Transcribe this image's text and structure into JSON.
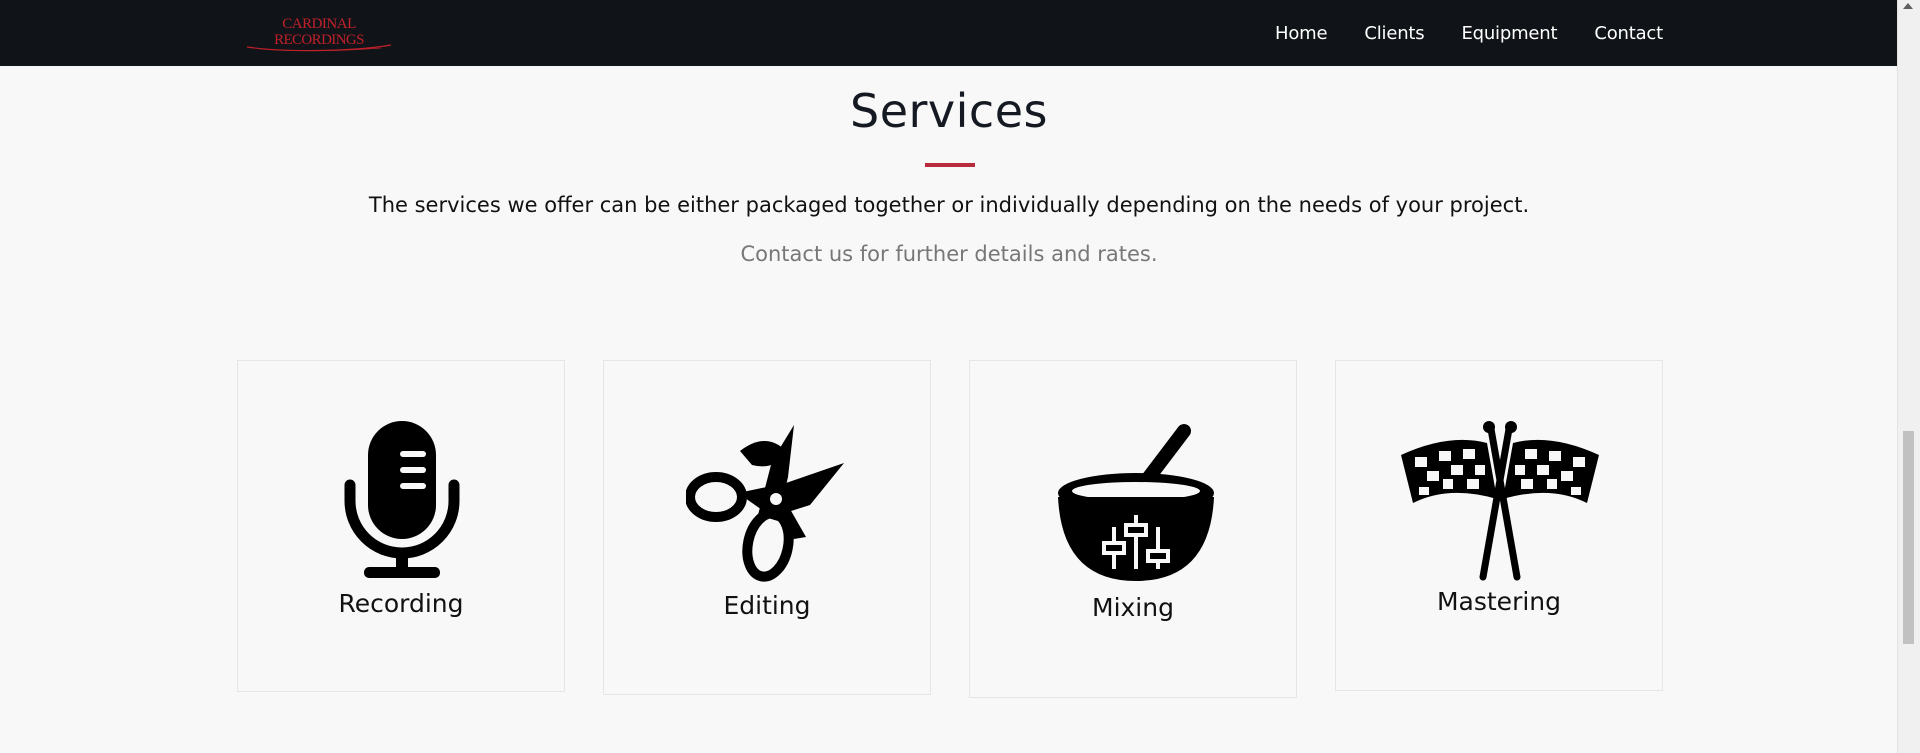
{
  "navbar": {
    "logo": {
      "line1": "CARDINAL",
      "line2": "RECORDINGS",
      "color": "#c0202a"
    },
    "links": [
      "Home",
      "Clients",
      "Equipment",
      "Contact"
    ]
  },
  "services": {
    "title": "Services",
    "accent_color": "#b72b3a",
    "intro": "The services we offer can be either packaged together or individually depending on the needs of your project.",
    "sub": "Contact us for further details and rates.",
    "cards": [
      {
        "label": "Recording",
        "icon": "microphone-icon"
      },
      {
        "label": "Editing",
        "icon": "scissors-icon"
      },
      {
        "label": "Mixing",
        "icon": "mixing-bowl-icon"
      },
      {
        "label": "Mastering",
        "icon": "checkered-flags-icon"
      }
    ]
  }
}
